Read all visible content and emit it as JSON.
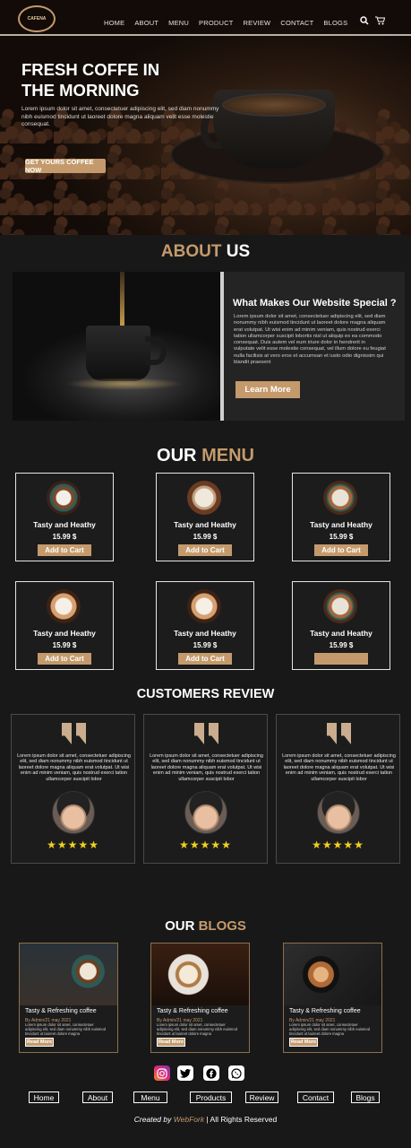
{
  "nav": {
    "logo_text": "CAFENA",
    "links": [
      "HOME",
      "ABOUT",
      "MENU",
      "PRODUCT",
      "REVIEW",
      "CONTACT",
      "BLOGS"
    ]
  },
  "hero": {
    "title_line1": "FRESH COFFE IN",
    "title_line2": "THE MORNING",
    "text": "Lorem ipsum dolor sit amet, consectetuer adipiscing elit, sed diam nonummy nibh euismod tincidunt ut laoreet dolore magna aliquam  velit esse molestie consequat.",
    "button": "GET YOURS COFFEE NOW"
  },
  "about": {
    "title_accent": "ABOUT",
    "title_rest": "US",
    "heading": "What Makes Our Website Special ?",
    "text": "Lorem ipsum dolor sit amet, consectetuer adipiscing elit, sed diam nonummy nibh euismod tincidunt ut laoreet dolore magna aliquam erat volutpat. Ut wisi enim ad minim veniam, quis nostrud exerci tation ullamcorper suscipit lobortis nisl ut aliquip ex ea commodo consequat. Duis autem vel eum iriure dolor in hendrerit in vulputate velit esse molestie consequat, vel illum dolore eu feugiat nulla facilisis at vero eros et accumsan et iusto odio dignissim qui blandit praesent",
    "button": "Learn More"
  },
  "menu": {
    "title_main": "OUR",
    "title_accent": "MENU",
    "items": [
      {
        "name": "Tasty and Heathy",
        "price": "15.99 $",
        "button": "Add to Cart"
      },
      {
        "name": "Tasty and Heathy",
        "price": "15.99 $",
        "button": "Add to Cart"
      },
      {
        "name": "Tasty and Heathy",
        "price": "15.99 $",
        "button": "Add to Cart"
      },
      {
        "name": "Tasty and Heathy",
        "price": "15.99 $",
        "button": "Add to Cart"
      },
      {
        "name": "Tasty and Heathy",
        "price": "15.99 $",
        "button": "Add to Cart"
      },
      {
        "name": "Tasty and Heathy",
        "price": "15.99 $",
        "button": ""
      }
    ]
  },
  "reviews": {
    "title": "CUSTOMERS REVIEW",
    "items": [
      {
        "text": "Lorem ipsum dolor sit amet, consectetuer adipiscing elit, sed diam nonummy nibh euismod tincidunt ut laoreet dolore magna aliquam erat volutpat. Ut wisi enim ad minim veniam, quis nostrud exerci tation ullamcorper suscipit lobor",
        "stars": "★★★★★"
      },
      {
        "text": "Lorem ipsum dolor sit amet, consectetuer adipiscing elit, sed diam nonummy nibh euismod tincidunt ut laoreet dolore magna aliquam erat volutpat. Ut wisi enim ad minim veniam, quis nostrud exerci tation ullamcorper suscipit lobor",
        "stars": "★★★★★"
      },
      {
        "text": "Lorem ipsum dolor sit amet, consectetuer adipiscing elit, sed diam nonummy nibh euismod tincidunt ut laoreet dolore magna aliquam erat volutpat. Ut wisi enim ad minim veniam, quis nostrud exerci tation ullamcorper suscipit lobor",
        "stars": "★★★★★"
      }
    ]
  },
  "blogs": {
    "title_main": "OUR",
    "title_accent": "BLOGS",
    "items": [
      {
        "title": "Tasty & Refreshing coffee",
        "meta": "By Admin/21 may 2021",
        "text": "Lorem ipsum dolor sit amet, consectetuer adipiscing elit, sed diam nonummy nibh euismod tincidunt ut laoreet dolore magna",
        "button": "Read More"
      },
      {
        "title": "Tasty & Refreshing coffee",
        "meta": "By Admin/21 may 2021",
        "text": "Lorem ipsum dolor sit amet, consectetuer adipiscing elit, sed diam nonummy nibh euismod tincidunt ut laoreet dolore magna",
        "button": "Read More"
      },
      {
        "title": "Tasty & Refreshing coffee",
        "meta": "By Admin/21 may 2021",
        "text": "Lorem ipsum dolor sit amet, consectetuer adipiscing elit, sed diam nonummy nibh euismod tincidunt ut laoreet dolore magna",
        "button": "Read More"
      }
    ]
  },
  "footer": {
    "social_icons": [
      "instagram-icon",
      "twitter-icon",
      "facebook-icon",
      "whatsapp-icon"
    ],
    "links": [
      "Home",
      "About",
      "Menu",
      "Products",
      "Review",
      "Contact",
      "Blogs"
    ],
    "credit_prefix": "Created by",
    "credit_brand": "WebFork",
    "credit_suffix": "| All Rights Reserved"
  },
  "colors": {
    "accent": "#c49a6c",
    "background": "#181818",
    "stars": "#f2d21b"
  }
}
